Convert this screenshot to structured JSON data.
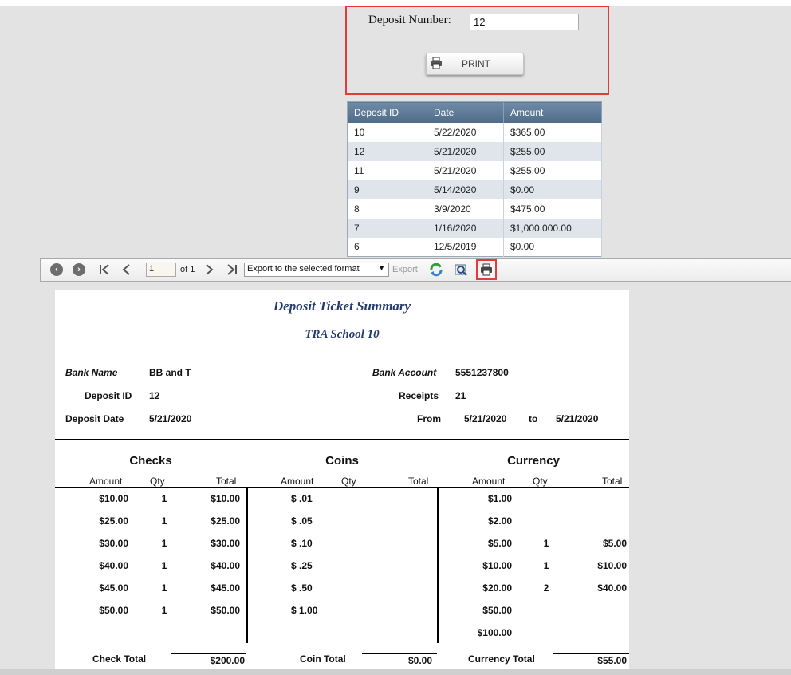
{
  "deposit_form": {
    "label": "Deposit Number:",
    "value": "12",
    "print_label": "PRINT"
  },
  "deposits_grid": {
    "columns": [
      "Deposit ID",
      "Date",
      "Amount"
    ],
    "rows": [
      [
        "10",
        "5/22/2020",
        "$365.00"
      ],
      [
        "12",
        "5/21/2020",
        "$255.00"
      ],
      [
        "11",
        "5/21/2020",
        "$255.00"
      ],
      [
        "9",
        "5/14/2020",
        "$0.00"
      ],
      [
        "8",
        "3/9/2020",
        "$475.00"
      ],
      [
        "7",
        "1/16/2020",
        "$1,000,000.00"
      ],
      [
        "6",
        "12/5/2019",
        "$0.00"
      ]
    ]
  },
  "viewer_toolbar": {
    "page_value": "1",
    "of_label": "of 1",
    "export_format": "Export to the selected format",
    "export_label": "Export"
  },
  "report": {
    "title": "Deposit Ticket Summary",
    "subtitle": "TRA School 10",
    "bank_name_label": "Bank Name",
    "bank_name": "BB and T",
    "deposit_id_label": "Deposit ID",
    "deposit_id": "12",
    "deposit_date_label": "Deposit Date",
    "deposit_date": "5/21/2020",
    "bank_account_label": "Bank Account",
    "bank_account": "5551237800",
    "receipts_label": "Receipts",
    "receipts": "21",
    "from_label": "From",
    "from_date": "5/21/2020",
    "to_label": "to",
    "to_date": "5/21/2020",
    "sections": {
      "checks": "Checks",
      "coins": "Coins",
      "currency": "Currency"
    },
    "col_headers": {
      "amount": "Amount",
      "qty": "Qty",
      "total": "Total"
    },
    "checks": [
      {
        "amount": "$10.00",
        "qty": "1",
        "total": "$10.00"
      },
      {
        "amount": "$25.00",
        "qty": "1",
        "total": "$25.00"
      },
      {
        "amount": "$30.00",
        "qty": "1",
        "total": "$30.00"
      },
      {
        "amount": "$40.00",
        "qty": "1",
        "total": "$40.00"
      },
      {
        "amount": "$45.00",
        "qty": "1",
        "total": "$45.00"
      },
      {
        "amount": "$50.00",
        "qty": "1",
        "total": "$50.00"
      }
    ],
    "coins": [
      {
        "amount": "$ .01",
        "qty": "",
        "total": ""
      },
      {
        "amount": "$ .05",
        "qty": "",
        "total": ""
      },
      {
        "amount": "$ .10",
        "qty": "",
        "total": ""
      },
      {
        "amount": "$ .25",
        "qty": "",
        "total": ""
      },
      {
        "amount": "$ .50",
        "qty": "",
        "total": ""
      },
      {
        "amount": "$ 1.00",
        "qty": "",
        "total": ""
      }
    ],
    "currency": [
      {
        "amount": "$1.00",
        "qty": "",
        "total": ""
      },
      {
        "amount": "$2.00",
        "qty": "",
        "total": ""
      },
      {
        "amount": "$5.00",
        "qty": "1",
        "total": "$5.00"
      },
      {
        "amount": "$10.00",
        "qty": "1",
        "total": "$10.00"
      },
      {
        "amount": "$20.00",
        "qty": "2",
        "total": "$40.00"
      },
      {
        "amount": "$50.00",
        "qty": "",
        "total": ""
      },
      {
        "amount": "$100.00",
        "qty": "",
        "total": ""
      }
    ],
    "check_total_label": "Check Total",
    "check_total": "$200.00",
    "coin_total_label": "Coin Total",
    "coin_total": "$0.00",
    "currency_total_label": "Currency Total",
    "currency_total": "$55.00"
  },
  "colors": {
    "highlight": "#e03c3c",
    "grid_header": "#5b7795",
    "report_title": "#253b70"
  }
}
